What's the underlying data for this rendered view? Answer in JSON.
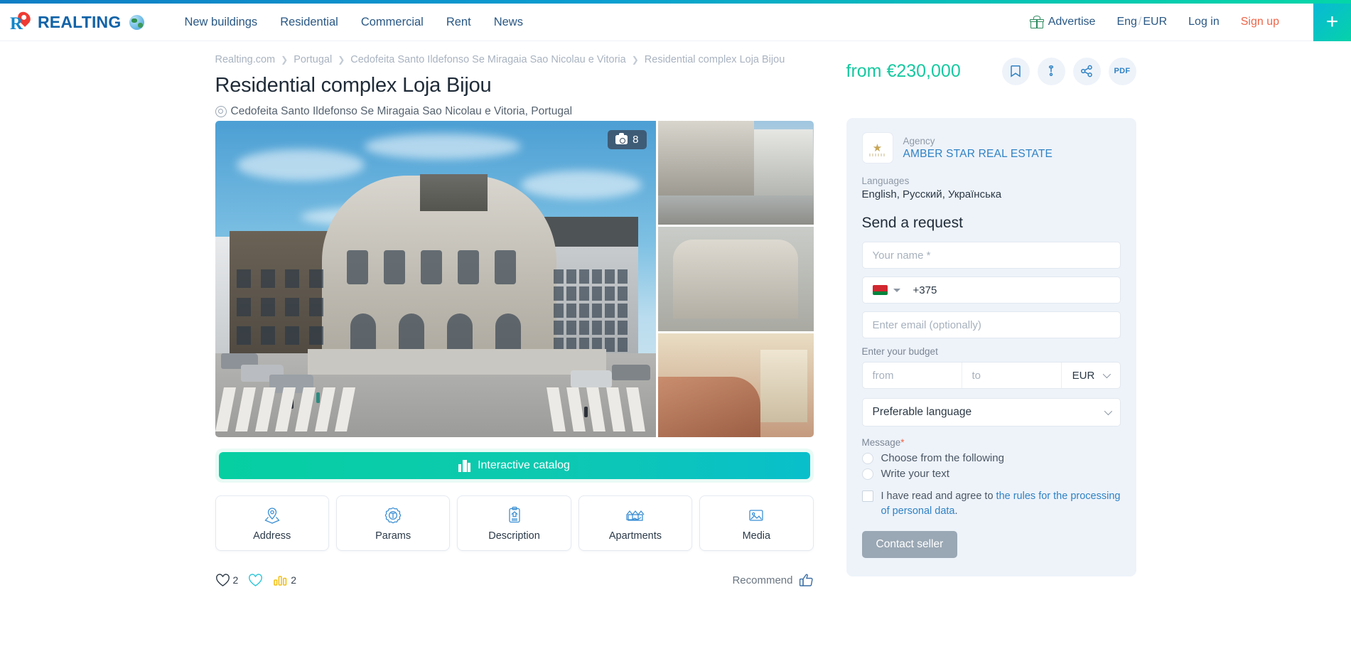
{
  "header": {
    "logo_text": "REALTING",
    "nav": [
      {
        "label": "New buildings"
      },
      {
        "label": "Residential"
      },
      {
        "label": "Commercial"
      },
      {
        "label": "Rent"
      },
      {
        "label": "News"
      }
    ],
    "advertise_label": "Advertise",
    "lang": "Eng",
    "lang_sep": "/",
    "currency": "EUR",
    "login_label": "Log in",
    "signup_label": "Sign up",
    "plus_label": "+"
  },
  "breadcrumb": [
    {
      "label": "Realting.com"
    },
    {
      "label": "Portugal"
    },
    {
      "label": "Cedofeita Santo Ildefonso Se Miragaia Sao Nicolau e Vitoria"
    },
    {
      "label": "Residential complex Loja Bijou"
    }
  ],
  "listing": {
    "title": "Residential complex Loja Bijou",
    "address": "Cedofeita Santo Ildefonso Se Miragaia Sao Nicolau e Vitoria, Portugal",
    "price": "from €230,000",
    "photo_count": "8"
  },
  "actions": {
    "bookmark": "bookmark-icon",
    "complain": "complain-icon",
    "share": "share-icon",
    "pdf_label": "PDF"
  },
  "catalog": {
    "label": "Interactive catalog"
  },
  "navcards": [
    {
      "label": "Address",
      "icon": "location-pin-icon"
    },
    {
      "label": "Params",
      "icon": "gear-params-icon"
    },
    {
      "label": "Description",
      "icon": "clipboard-icon"
    },
    {
      "label": "Apartments",
      "icon": "apartments-icon"
    },
    {
      "label": "Media",
      "icon": "image-icon"
    }
  ],
  "stats": {
    "favorites_count": "2",
    "views_count": "2",
    "recommend_label": "Recommend"
  },
  "sidebar": {
    "agency_kicker": "Agency",
    "agency_name": "AMBER STAR REAL ESTATE",
    "languages_label": "Languages",
    "languages_value": "English, Русский, Українська",
    "form_title": "Send a request",
    "name_placeholder": "Your name *",
    "phone_code": "+375",
    "email_placeholder": "Enter email (optionally)",
    "budget_label": "Enter your budget",
    "budget_from_placeholder": "from",
    "budget_to_placeholder": "to",
    "currency_value": "EUR",
    "language_select_value": "Preferable language",
    "message_label": "Message",
    "message_required": "*",
    "radio_choose": "Choose from the following",
    "radio_write": "Write your text",
    "agree_prefix": "I have read and agree to ",
    "agree_link": "the rules for the processing of personal data",
    "agree_suffix": ".",
    "submit_label": "Contact seller"
  },
  "colors": {
    "accent_teal": "#17c8a0",
    "link_blue": "#2f82c4",
    "nav_blue": "#2a5885",
    "signup_orange": "#ef6548",
    "sidebar_bg": "#eef3fa"
  }
}
